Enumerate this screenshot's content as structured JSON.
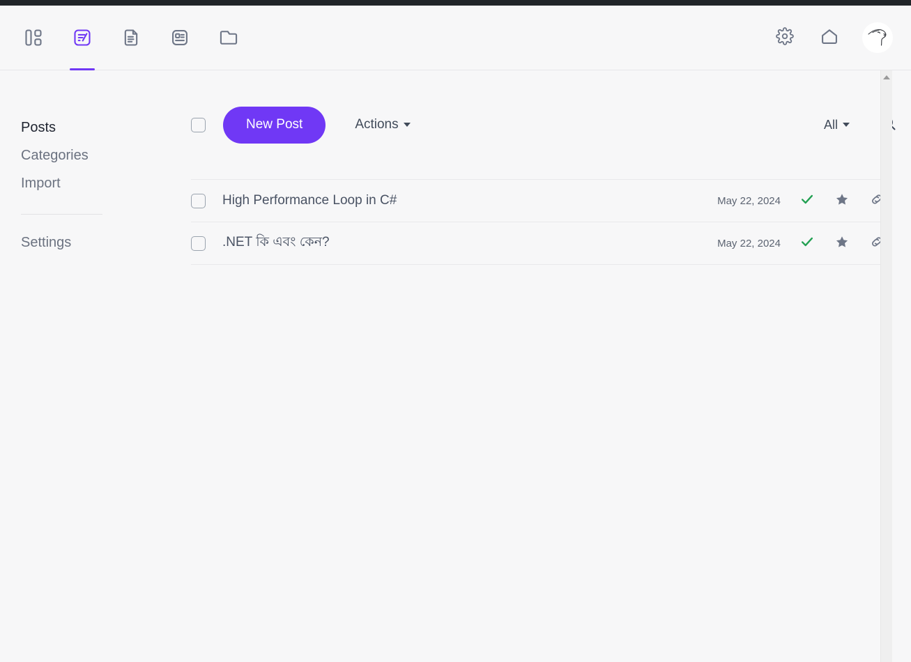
{
  "theme": {
    "accent": "#7038f5",
    "page_bg": "#f7f7f8",
    "top_strip": "#212529",
    "check_green": "#22a052",
    "star_gray": "#6e7687",
    "text_muted": "#6b7280"
  },
  "header": {
    "tabs": [
      {
        "icon": "dashboard-icon",
        "name": "dashboard",
        "active": false
      },
      {
        "icon": "post-edit-icon",
        "name": "posts",
        "active": true
      },
      {
        "icon": "page-document-icon",
        "name": "pages",
        "active": false
      },
      {
        "icon": "contact-card-icon",
        "name": "contacts",
        "active": false
      },
      {
        "icon": "folder-icon",
        "name": "files",
        "active": false
      }
    ],
    "actions": [
      {
        "icon": "gear-icon",
        "name": "settings"
      },
      {
        "icon": "home-icon",
        "name": "home"
      }
    ],
    "avatar": {
      "icon": "user-avatar-sketch",
      "name": "account"
    }
  },
  "sidebar": {
    "items": [
      {
        "label": "Posts",
        "active": true
      },
      {
        "label": "Categories",
        "active": false
      },
      {
        "label": "Import",
        "active": false
      }
    ],
    "footer_items": [
      {
        "label": "Settings",
        "active": false
      }
    ]
  },
  "toolbar": {
    "select_all_checked": false,
    "new_post_label": "New Post",
    "actions_label": "Actions",
    "filter_label": "All",
    "search_icon": "search-icon"
  },
  "posts": {
    "rows": [
      {
        "title": "High Performance Loop in C#",
        "date": "May 22, 2024",
        "checked": false,
        "published": true,
        "featured": true,
        "link_icon": "link-icon"
      },
      {
        "title": ".NET কি এবং কেন?",
        "date": "May 22, 2024",
        "checked": false,
        "published": true,
        "featured": true,
        "link_icon": "link-icon"
      }
    ]
  },
  "scrollbar": {
    "up_arrow": "scroll-up-arrow"
  }
}
